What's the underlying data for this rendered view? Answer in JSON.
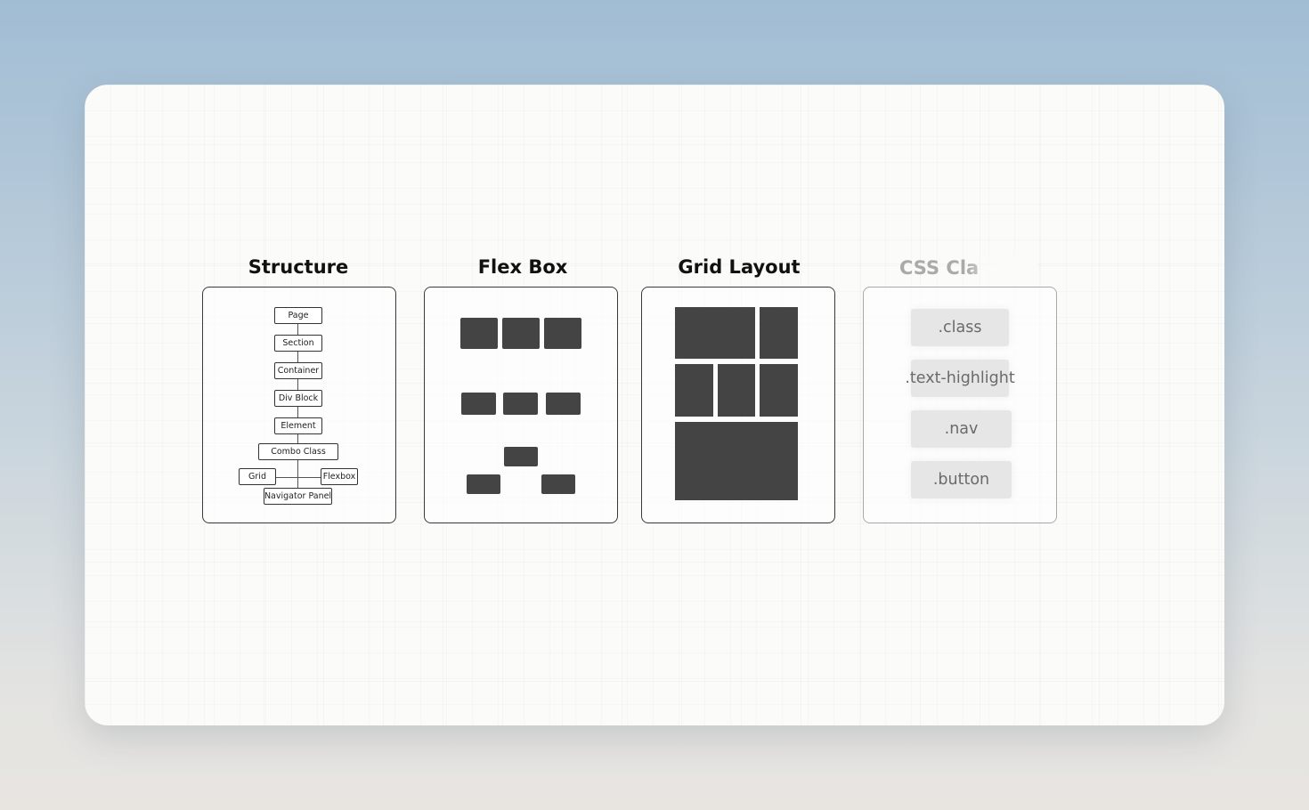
{
  "titles": {
    "structure": "Structure",
    "flexbox": "Flex Box",
    "grid": "Grid Layout",
    "css": "CSS Cla"
  },
  "structure_nodes": {
    "page": "Page",
    "section": "Section",
    "container": "Container",
    "div_block": "Div Block",
    "element": "Element",
    "combo_class": "Combo Class",
    "grid": "Grid",
    "flexbox": "Flexbox",
    "navigator_panel": "Navigator Panel"
  },
  "css_classes": [
    ".class",
    ".text-highlight",
    ".nav",
    ".button"
  ],
  "colors": {
    "block": "#444444",
    "card_background": "#fbfbfa",
    "chip_background": "#e6e6e6"
  }
}
